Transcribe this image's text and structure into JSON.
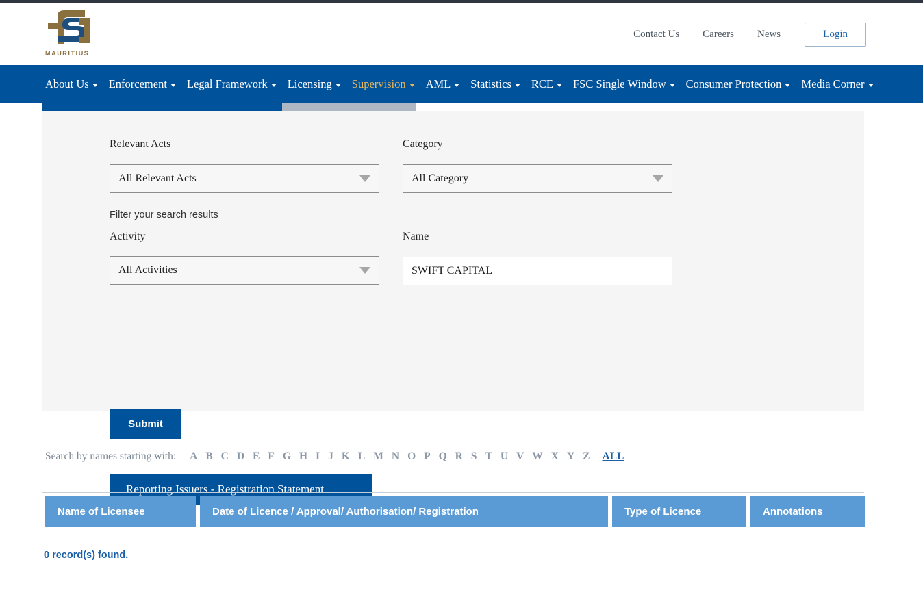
{
  "header": {
    "logo_text": "MAURITIUS",
    "links": [
      {
        "label": "Contact Us"
      },
      {
        "label": "Careers"
      },
      {
        "label": "News"
      }
    ],
    "login_label": "Login"
  },
  "mainnav": {
    "items": [
      {
        "label": "About Us",
        "active": false
      },
      {
        "label": "Enforcement",
        "active": false
      },
      {
        "label": "Legal Framework",
        "active": false
      },
      {
        "label": "Licensing",
        "active": false
      },
      {
        "label": "Supervision",
        "active": true
      },
      {
        "label": "AML",
        "active": false
      },
      {
        "label": "Statistics",
        "active": false
      },
      {
        "label": "RCE",
        "active": false
      },
      {
        "label": "FSC Single Window",
        "active": false
      },
      {
        "label": "Consumer Protection",
        "active": false
      },
      {
        "label": "Media Corner",
        "active": false
      }
    ]
  },
  "form": {
    "relevant_acts_label": "Relevant Acts",
    "relevant_acts_value": "All Relevant Acts",
    "category_label": "Category",
    "category_value": "All Category",
    "filter_note": "Filter your search results",
    "activity_label": "Activity",
    "activity_value": "All Activities",
    "name_label": "Name",
    "name_value": "SWIFT CAPITAL",
    "submit_label": "Submit",
    "reporting_label": "Reporting Issuers - Registration Statement"
  },
  "alpha": {
    "label": "Search by names starting with:",
    "letters": [
      "A",
      "B",
      "C",
      "D",
      "E",
      "F",
      "G",
      "H",
      "I",
      "J",
      "K",
      "L",
      "M",
      "N",
      "O",
      "P",
      "Q",
      "R",
      "S",
      "T",
      "U",
      "V",
      "W",
      "X",
      "Y",
      "Z"
    ],
    "all_label": "ALL"
  },
  "table": {
    "columns": [
      {
        "label": "Name of Licensee"
      },
      {
        "label": "Date of Licence / Approval/ Authorisation/ Registration"
      },
      {
        "label": "Type of Licence"
      },
      {
        "label": "Annotations"
      }
    ],
    "rows": [],
    "records_found": "0 record(s) found."
  },
  "colors": {
    "nav_blue": "#00529b",
    "accent_gold": "#e8b55b",
    "table_header_blue": "#5b9bd5",
    "panel_gray": "#f5f5f5",
    "link_blue": "#1a5fa8"
  }
}
